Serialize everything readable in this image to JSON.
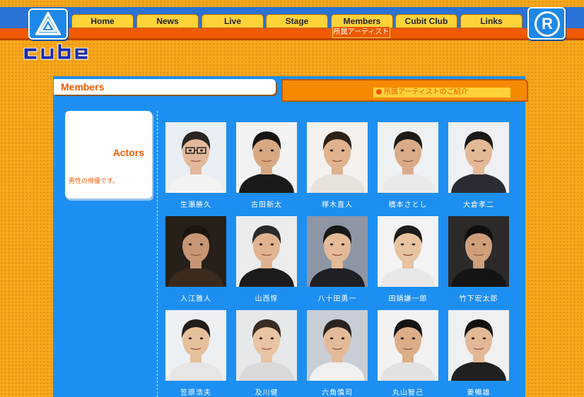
{
  "nav": {
    "tabs": [
      {
        "label": "Home"
      },
      {
        "label": "News"
      },
      {
        "label": "Live"
      },
      {
        "label": "Stage"
      },
      {
        "label": "Members"
      },
      {
        "label": "Cubit Club"
      },
      {
        "label": "Links"
      }
    ],
    "active_tab": "Members",
    "sub_label": "所属アーティスト"
  },
  "page": {
    "title": "Members",
    "intro_link": "所属アーティストのご紹介"
  },
  "sidebar": {
    "heading": "Actors",
    "description": "男性の俳優です。"
  },
  "members": [
    {
      "name": "生瀬勝久",
      "bg": "#e9eef4",
      "shirt": "#f2f2f2",
      "hair": "#2a2520",
      "skin": "#e2b89a",
      "glasses": true
    },
    {
      "name": "古田新太",
      "bg": "#f2f2f2",
      "shirt": "#1a1a1a",
      "hair": "#161412",
      "skin": "#d8a882",
      "glasses": false
    },
    {
      "name": "﨔木直人",
      "bg": "#f4f1ee",
      "shirt": "#e7e2dc",
      "hair": "#2c2118",
      "skin": "#e0b28e",
      "glasses": false
    },
    {
      "name": "橋本さとし",
      "bg": "#eef1f2",
      "shirt": "#eaeaea",
      "hair": "#1e1a18",
      "skin": "#d9ab88",
      "glasses": false
    },
    {
      "name": "大倉孝二",
      "bg": "#eef0f3",
      "shirt": "#2a2c34",
      "hair": "#1a1816",
      "skin": "#e3b996",
      "glasses": false
    },
    {
      "name": "入江雅人",
      "bg": "#262018",
      "shirt": "#3b2a1e",
      "hair": "#1c1410",
      "skin": "#c79674",
      "glasses": false
    },
    {
      "name": "山西惇",
      "bg": "#ececec",
      "shirt": "#1c1c1c",
      "hair": "#2a2a2a",
      "skin": "#e0b390",
      "glasses": false
    },
    {
      "name": "八十田勇一",
      "bg": "#8e96a6",
      "shirt": "#1e2026",
      "hair": "#181818",
      "skin": "#e4bb98",
      "glasses": false
    },
    {
      "name": "田鍋謙一郎",
      "bg": "#f3f3f3",
      "shirt": "#e8e8e8",
      "hair": "#1e1b18",
      "skin": "#e8c3a0",
      "glasses": false
    },
    {
      "name": "竹下宏太郎",
      "bg": "#2c2a28",
      "shirt": "#141414",
      "hair": "#0f0e0d",
      "skin": "#cf9f7c",
      "glasses": false
    },
    {
      "name": "笠原浩夫",
      "bg": "#edf0f3",
      "shirt": "#e6e6e6",
      "hair": "#221d19",
      "skin": "#e6bf9b",
      "glasses": false
    },
    {
      "name": "及川健",
      "bg": "#e6e8ea",
      "shirt": "#dadada",
      "hair": "#3a2c22",
      "skin": "#e8c4a2",
      "glasses": false
    },
    {
      "name": "六角慎司",
      "bg": "#c8cdd6",
      "shirt": "#f0f0f0",
      "hair": "#2a2420",
      "skin": "#e4bb98",
      "glasses": false
    },
    {
      "name": "丸山智己",
      "bg": "#f2f2f2",
      "shirt": "#e2e2e2",
      "hair": "#151312",
      "skin": "#dcae88",
      "glasses": false
    },
    {
      "name": "姜暢雄",
      "bg": "#f0f0f0",
      "shirt": "#202020",
      "hair": "#141210",
      "skin": "#e2b896",
      "glasses": false
    }
  ],
  "colors": {
    "accent": "#f05a00",
    "nav_blue": "#2a72d6",
    "content_blue": "#1d8ff2",
    "tab_yellow": "#ffd23a"
  },
  "icons": {
    "brand": "triangle-logo-icon",
    "registered": "registered-icon"
  }
}
